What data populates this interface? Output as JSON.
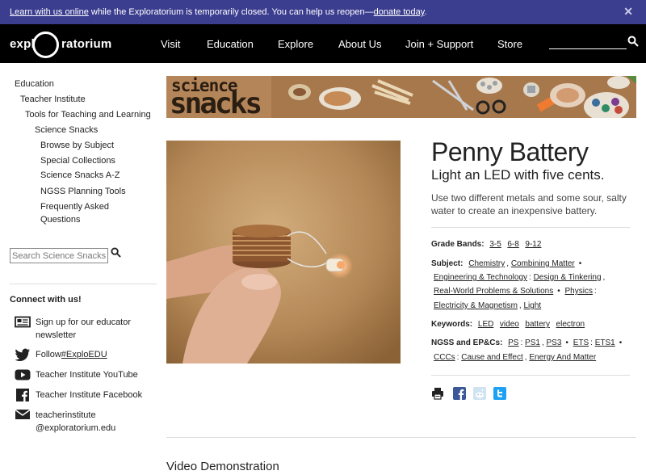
{
  "notice": {
    "learn_link": "Learn with us online",
    "text": " while the Exploratorium is temporarily closed. You can help us reopen—",
    "donate_link": "donate today",
    "end": "."
  },
  "header": {
    "logo_left": "expl",
    "logo_right": "ratorium",
    "nav": [
      "Visit",
      "Education",
      "Explore",
      "About Us",
      "Join + Support",
      "Store"
    ]
  },
  "sidebar": {
    "breadcrumbs": [
      "Education",
      "Teacher Institute",
      "Tools for Teaching and Learning",
      "Science Snacks",
      "Browse by Subject",
      "Special Collections",
      "Science Snacks A-Z",
      "NGSS Planning Tools",
      "Frequently Asked",
      "Questions"
    ],
    "search_placeholder": "Search Science Snacks",
    "connect_title": "Connect with us!",
    "social": {
      "newsletter_1": "Sign up for our educator",
      "newsletter_2": "newsletter",
      "twitter_prefix": "Follow ",
      "twitter_link": "#ExploEDU",
      "youtube": "Teacher Institute YouTube",
      "facebook": "Teacher Institute Facebook",
      "email_1": "teacherinstitute",
      "email_2": "@exploratorium.edu"
    }
  },
  "banner": {
    "word1": "science",
    "word2": "snacks"
  },
  "snack": {
    "title": "Penny Battery",
    "subtitle": "Light an LED with five cents.",
    "description": "Use two different metals and some sour, salty water to create an inexpensive battery."
  },
  "meta": {
    "grade_label": "Grade Bands:",
    "grades": [
      "3-5",
      "6-8",
      "9-12"
    ],
    "subject_label": "Subject:",
    "subjects": [
      "Chemistry",
      "Combining Matter",
      "Engineering & Technology",
      "Design & Tinkering",
      "Real-World Problems & Solutions",
      "Physics",
      "Electricity & Magnetism",
      "Light"
    ],
    "keywords_label": "Keywords:",
    "keywords": [
      "LED",
      "video",
      "battery",
      "electron"
    ],
    "ngss_label": "NGSS and EP&Cs:",
    "ngss": [
      "PS",
      "PS1",
      "PS3",
      "ETS",
      "ETS1",
      "CCCs",
      "Cause and Effect",
      "Energy And Matter"
    ]
  },
  "share_icons": [
    "print-icon",
    "facebook-icon",
    "reddit-icon",
    "twitter-icon"
  ],
  "section": {
    "video_title": "Video Demonstration"
  },
  "colors": {
    "notice_bg": "#3b3d8f",
    "header_bg": "#000000",
    "facebook": "#3b5998",
    "twitter": "#1da1f2",
    "reddit": "#cfe3f3"
  }
}
